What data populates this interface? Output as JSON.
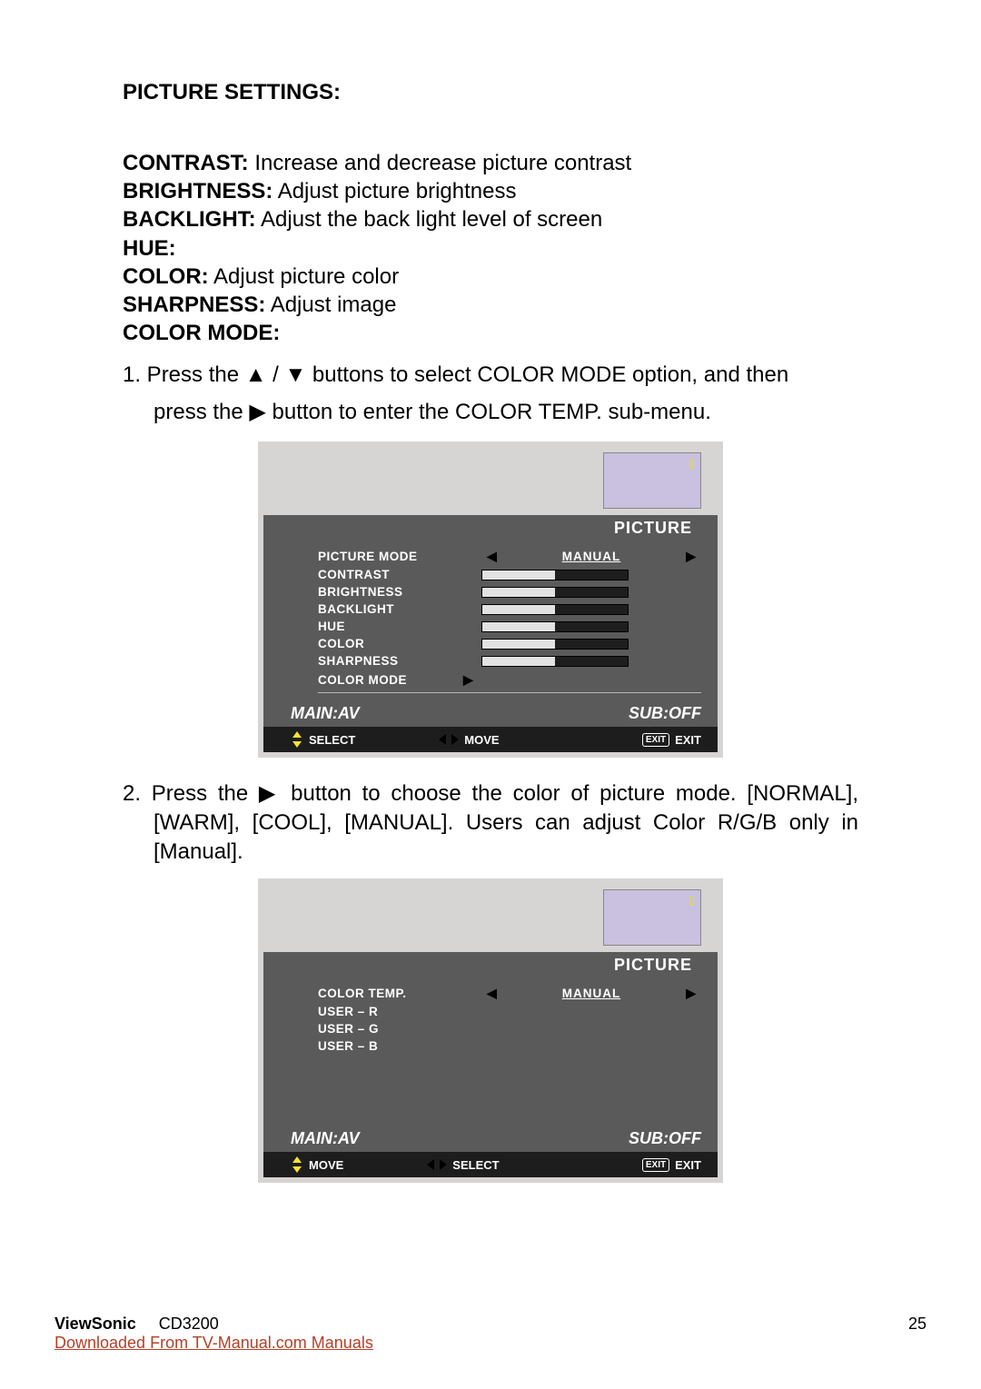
{
  "heading": "PICTURE SETTINGS:",
  "definitions": [
    {
      "term": "CONTRAST:",
      "desc": " Increase and decrease picture contrast"
    },
    {
      "term": "BRIGHTNESS:",
      "desc": " Adjust picture brightness"
    },
    {
      "term": "BACKLIGHT:",
      "desc": " Adjust the back light level of screen"
    },
    {
      "term": "HUE:",
      "desc": ""
    },
    {
      "term": "COLOR:",
      "desc": " Adjust picture color"
    },
    {
      "term": "SHARPNESS:",
      "desc": " Adjust image"
    },
    {
      "term": "COLOR MODE:",
      "desc": ""
    }
  ],
  "step1_a": "1. Press the ▲ / ▼ buttons to select COLOR MODE option, and then",
  "step1_b": "press the ▶ button to enter the COLOR TEMP. sub-menu.",
  "step2": "2. Press the ▶ button to choose the color of picture mode. [NORMAL], [WARM], [COOL], [MANUAL]. Users can adjust Color R/G/B only in [Manual].",
  "osd1": {
    "ind": "▯",
    "title": "PICTURE",
    "rows": [
      {
        "label": "PICTURE  MODE",
        "type": "select",
        "value": "MANUAL"
      },
      {
        "label": "CONTRAST",
        "type": "slider",
        "pct": 50
      },
      {
        "label": "BRIGHTNESS",
        "type": "slider",
        "pct": 50
      },
      {
        "label": "BACKLIGHT",
        "type": "slider",
        "pct": 50
      },
      {
        "label": "HUE",
        "type": "slider",
        "pct": 50
      },
      {
        "label": "COLOR",
        "type": "slider",
        "pct": 50
      },
      {
        "label": "SHARPNESS",
        "type": "slider",
        "pct": 50
      },
      {
        "label": "COLOR MODE",
        "type": "enter",
        "underline": true
      }
    ],
    "status_left": "MAIN:AV",
    "status_right": "SUB:OFF",
    "nav": [
      {
        "icon": "ud",
        "text": "SELECT"
      },
      {
        "icon": "lr",
        "text": "MOVE"
      },
      {
        "icon": "exit",
        "text": "EXIT"
      }
    ]
  },
  "osd2": {
    "ind": "▯",
    "title": "PICTURE",
    "rows": [
      {
        "label": "COLOR  TEMP.",
        "type": "select",
        "value": "MANUAL"
      },
      {
        "label": "USER – R",
        "type": "blank"
      },
      {
        "label": "USER – G",
        "type": "blank"
      },
      {
        "label": "USER – B",
        "type": "blank"
      }
    ],
    "status_left": "MAIN:AV",
    "status_right": "SUB:OFF",
    "nav": [
      {
        "icon": "ud",
        "text": "MOVE"
      },
      {
        "icon": "lr",
        "text": "SELECT"
      },
      {
        "icon": "exit",
        "text": "EXIT"
      }
    ]
  },
  "footer": {
    "brand": "ViewSonic",
    "model": "CD3200",
    "link": "Downloaded From TV-Manual.com Manuals",
    "page": "25"
  }
}
